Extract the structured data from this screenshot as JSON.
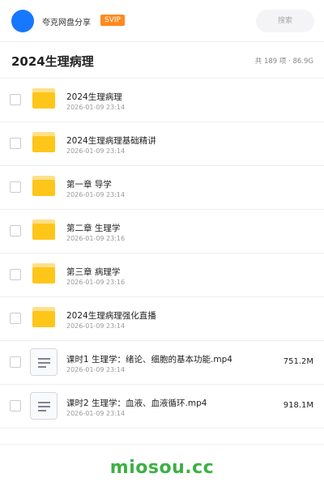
{
  "header": {
    "brand": "夸克网盘分享",
    "badge": "SVIP",
    "search_placeholder": "搜索",
    "accent_color": "#1677ff",
    "badge_color": "#ff8a1f"
  },
  "folder_header": {
    "title": "2024生理病理",
    "summary": "共 189 项 · 86.9G"
  },
  "items": [
    {
      "type": "folder",
      "icon": "folder-icon",
      "name": "2024生理病理",
      "date": "2026-01-09 23:14",
      "size": ""
    },
    {
      "type": "folder",
      "icon": "folder-icon",
      "name": "2024生理病理基础精讲",
      "date": "2026-01-09 23:14",
      "size": ""
    },
    {
      "type": "folder",
      "icon": "folder-icon",
      "name": "第一章 导学",
      "date": "2026-01-09 23:14",
      "size": ""
    },
    {
      "type": "folder",
      "icon": "folder-icon",
      "name": "第二章 生理学",
      "date": "2026-01-09 23:16",
      "size": ""
    },
    {
      "type": "folder",
      "icon": "folder-icon",
      "name": "第三章 病理学",
      "date": "2026-01-09 23:16",
      "size": ""
    },
    {
      "type": "folder",
      "icon": "folder-icon",
      "name": "2024生理病理强化直播",
      "date": "2026-01-09 23:14",
      "size": ""
    },
    {
      "type": "file",
      "icon": "document-icon",
      "name": "课时1   生理学：绪论、细胞的基本功能.mp4",
      "date": "2026-01-09 23:14",
      "size": "751.2M"
    },
    {
      "type": "file",
      "icon": "document-icon",
      "name": "课时2   生理学：血液、血液循环.mp4",
      "date": "2026-01-09 23:14",
      "size": "918.1M"
    }
  ],
  "watermark": "miosou.cc"
}
